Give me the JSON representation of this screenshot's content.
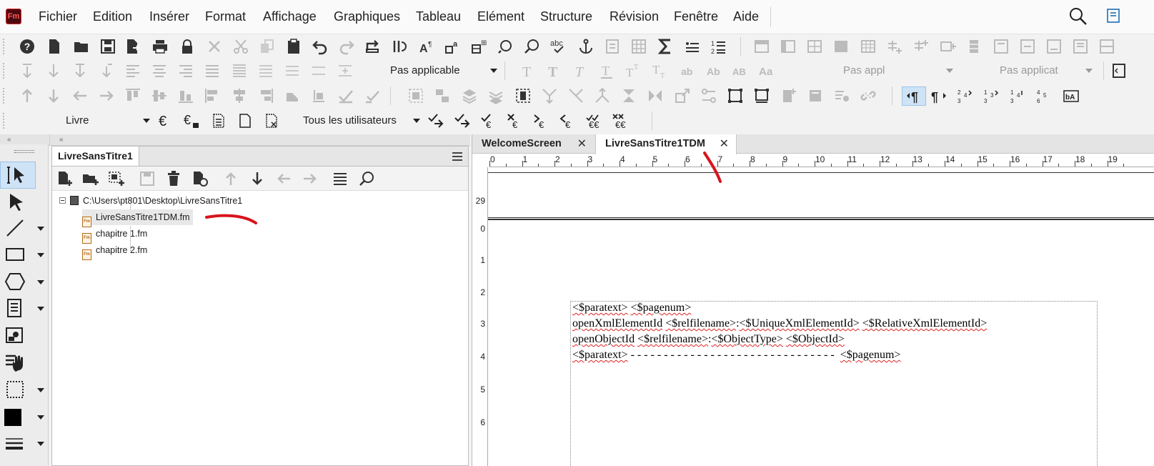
{
  "menubar": {
    "logo": "Fm",
    "items": [
      "Fichier",
      "Edition",
      "Insérer",
      "Format",
      "Affichage",
      "Graphiques",
      "Tableau",
      "Elément",
      "Structure",
      "Révision",
      "Fenêtre",
      "Aide"
    ]
  },
  "toolbar2": {
    "para_tag_value": "Pas applicable",
    "char_tag_value": "Pas appl",
    "table_tag_value": "Pas applicat"
  },
  "toolbar4": {
    "view_value": "Livre",
    "user_value": "Tous les utilisateurs"
  },
  "book_panel": {
    "tab_label": "LivreSansTitre1",
    "root_path": "C:\\Users\\pt801\\Desktop\\LivreSansTitre1",
    "files": [
      {
        "name": "LivreSansTitre1TDM.fm",
        "selected": true
      },
      {
        "name": "chapitre 1.fm",
        "selected": false
      },
      {
        "name": "chapitre 2.fm",
        "selected": false
      }
    ]
  },
  "doc_tabs": [
    {
      "label": "WelcomeScreen",
      "active": false
    },
    {
      "label": "LivreSansTitre1TDM",
      "active": true
    }
  ],
  "ruler": {
    "h_numbers": [
      "0",
      "1",
      "2",
      "3",
      "4",
      "5",
      "6",
      "7",
      "8",
      "9",
      "10",
      "11",
      "12",
      "13",
      "14",
      "15",
      "16",
      "17",
      "18",
      "19"
    ],
    "v_numbers": [
      "29",
      "0",
      "1",
      "2",
      "3",
      "4",
      "5",
      "6"
    ]
  },
  "document": {
    "lines": [
      [
        "<$paratext>",
        " ",
        "<$pagenum>"
      ],
      [
        "openXmlElementId",
        " ",
        "<$relfilename>",
        ":",
        "<$UniqueXmlElementId>",
        " ",
        "<$RelativeXmlElementId>"
      ],
      [
        "openObjectId",
        " ",
        "<$relfilename>",
        ":",
        "<$ObjectType>",
        " ",
        "<$ObjectId>"
      ],
      [
        "<$paratext>",
        " - - - - - - - - - - - - - - - - - - - - - - - - - - - - - - -  ",
        "<$pagenum>"
      ]
    ]
  },
  "colors": {
    "accent_red": "#d8141c",
    "logo_bg": "#4a0a10",
    "selected_tool": "#cfe3f7"
  }
}
